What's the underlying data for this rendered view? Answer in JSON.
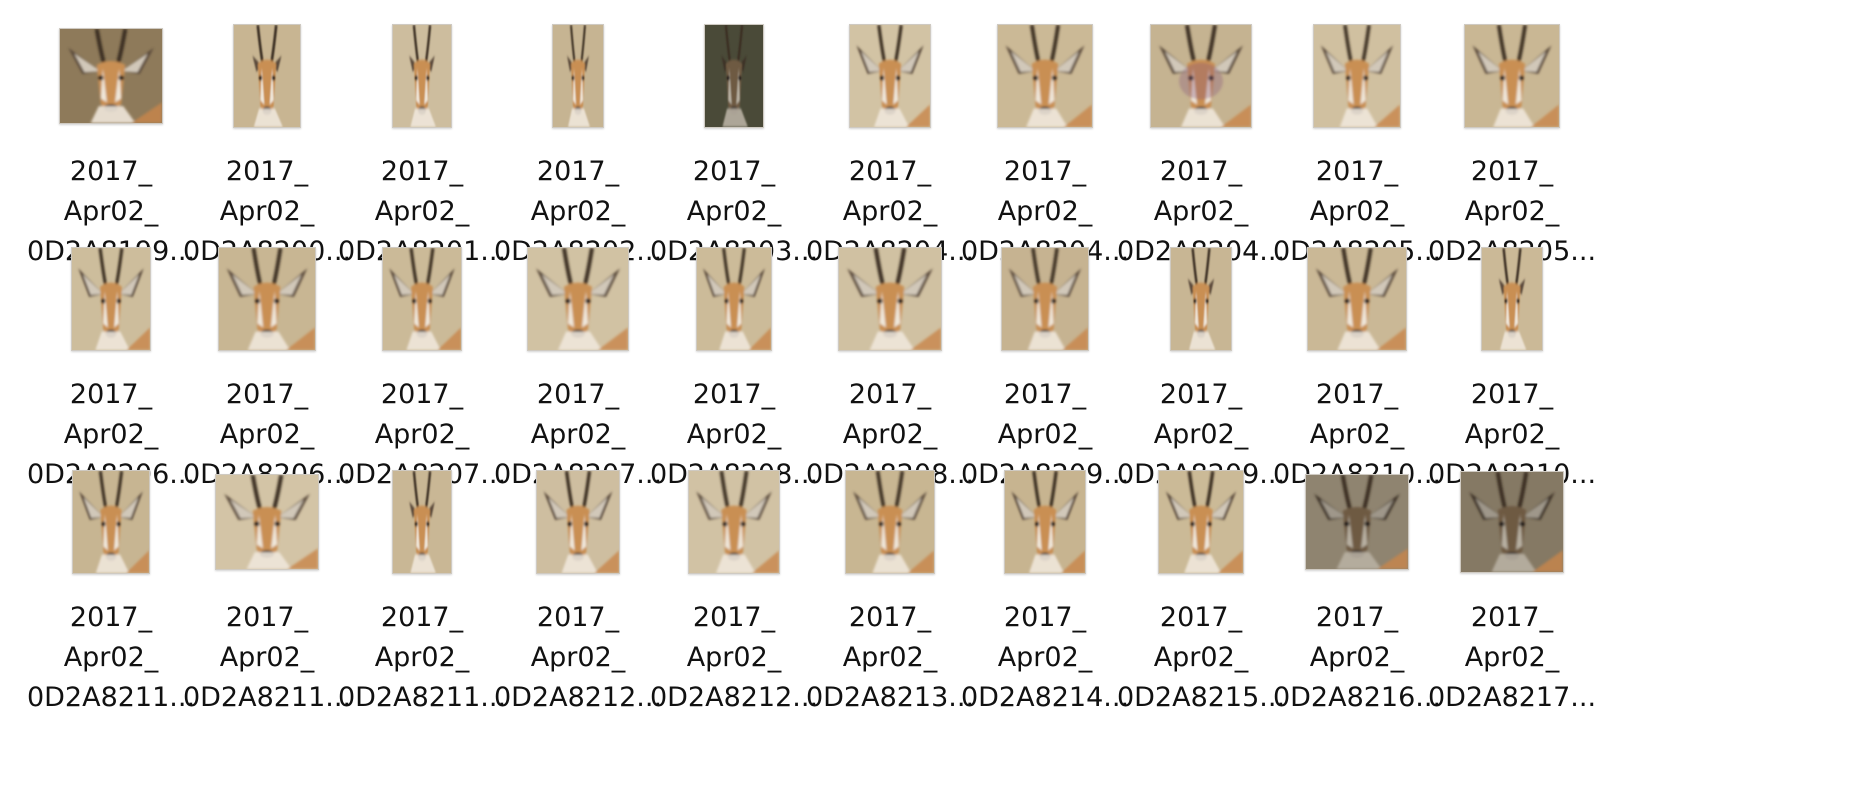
{
  "files": [
    {
      "line1": "2017_",
      "line2": "Apr02_",
      "line3": "0D2A8199...",
      "thumb": "gazelle-head-closeup",
      "bg": "#8e7a5a"
    },
    {
      "line1": "2017_",
      "line2": "Apr02_",
      "line3": "0D2A8200...",
      "thumb": "gazelle-horns",
      "bg": "#c8b592"
    },
    {
      "line1": "2017_",
      "line2": "Apr02_",
      "line3": "0D2A8201...",
      "thumb": "gazelle-horns",
      "bg": "#cdbd9e"
    },
    {
      "line1": "2017_",
      "line2": "Apr02_",
      "line3": "0D2A8202...",
      "thumb": "gazelle-horns",
      "bg": "#c6b492"
    },
    {
      "line1": "2017_",
      "line2": "Apr02_",
      "line3": "0D2A8203...",
      "thumb": "gazelle-horns-dark",
      "bg": "#4a4a38"
    },
    {
      "line1": "2017_",
      "line2": "Apr02_",
      "line3": "0D2A8204...",
      "thumb": "gazelle-face",
      "bg": "#d2c3a4"
    },
    {
      "line1": "2017_",
      "line2": "Apr02_",
      "line3": "0D2A8204...",
      "thumb": "gazelle-face",
      "bg": "#cbb996"
    },
    {
      "line1": "2017_",
      "line2": "Apr02_",
      "line3": "0D2A8204...",
      "thumb": "gazelle-face-purple",
      "bg": "#c5b391"
    },
    {
      "line1": "2017_",
      "line2": "Apr02_",
      "line3": "0D2A8205...",
      "thumb": "gazelle-face",
      "bg": "#d0c0a0"
    },
    {
      "line1": "2017_",
      "line2": "Apr02_",
      "line3": "0D2A8205...",
      "thumb": "gazelle-face",
      "bg": "#c9b794"
    },
    {
      "line1": "2017_",
      "line2": "Apr02_",
      "line3": "0D2A8206...",
      "thumb": "gazelle-face",
      "bg": "#cdbd9c"
    },
    {
      "line1": "2017_",
      "line2": "Apr02_",
      "line3": "0D2A8206...",
      "thumb": "gazelle-face",
      "bg": "#c8b693"
    },
    {
      "line1": "2017_",
      "line2": "Apr02_",
      "line3": "0D2A8207...",
      "thumb": "gazelle-face",
      "bg": "#cbba98"
    },
    {
      "line1": "2017_",
      "line2": "Apr02_",
      "line3": "0D2A8207...",
      "thumb": "gazelle-face",
      "bg": "#d1c2a3"
    },
    {
      "line1": "2017_",
      "line2": "Apr02_",
      "line3": "0D2A8208...",
      "thumb": "gazelle-face",
      "bg": "#ccbb99"
    },
    {
      "line1": "2017_",
      "line2": "Apr02_",
      "line3": "0D2A8208...",
      "thumb": "gazelle-face",
      "bg": "#d0c1a2"
    },
    {
      "line1": "2017_",
      "line2": "Apr02_",
      "line3": "0D2A8209...",
      "thumb": "gazelle-face",
      "bg": "#c6b391"
    },
    {
      "line1": "2017_",
      "line2": "Apr02_",
      "line3": "0D2A8209...",
      "thumb": "gazelle-horns",
      "bg": "#c8b694"
    },
    {
      "line1": "2017_",
      "line2": "Apr02_",
      "line3": "0D2A8210...",
      "thumb": "gazelle-face",
      "bg": "#cab896"
    },
    {
      "line1": "2017_",
      "line2": "Apr02_",
      "line3": "0D2A8210...",
      "thumb": "gazelle-horns",
      "bg": "#cbb997"
    },
    {
      "line1": "2017_",
      "line2": "Apr02_",
      "line3": "0D2A8211...",
      "thumb": "gazelle-face",
      "bg": "#c7b592"
    },
    {
      "line1": "2017_",
      "line2": "Apr02_",
      "line3": "0D2A8211...",
      "thumb": "gazelle-face",
      "bg": "#d3c4a6"
    },
    {
      "line1": "2017_",
      "line2": "Apr02_",
      "line3": "0D2A8211...",
      "thumb": "gazelle-horns",
      "bg": "#c9b795"
    },
    {
      "line1": "2017_",
      "line2": "Apr02_",
      "line3": "0D2A8212...",
      "thumb": "gazelle-face",
      "bg": "#cebea0"
    },
    {
      "line1": "2017_",
      "line2": "Apr02_",
      "line3": "0D2A8212...",
      "thumb": "gazelle-face",
      "bg": "#d1c2a4"
    },
    {
      "line1": "2017_",
      "line2": "Apr02_",
      "line3": "0D2A8213...",
      "thumb": "gazelle-face",
      "bg": "#c8b692"
    },
    {
      "line1": "2017_",
      "line2": "Apr02_",
      "line3": "0D2A8214...",
      "thumb": "gazelle-face",
      "bg": "#c7b490"
    },
    {
      "line1": "2017_",
      "line2": "Apr02_",
      "line3": "0D2A8215...",
      "thumb": "gazelle-face",
      "bg": "#cbba97"
    },
    {
      "line1": "2017_",
      "line2": "Apr02_",
      "line3": "0D2A8216...",
      "thumb": "gazelle-face-dark",
      "bg": "#8f8470"
    },
    {
      "line1": "2017_",
      "line2": "Apr02_",
      "line3": "0D2A8217...",
      "thumb": "gazelle-face-dark",
      "bg": "#857964"
    }
  ]
}
